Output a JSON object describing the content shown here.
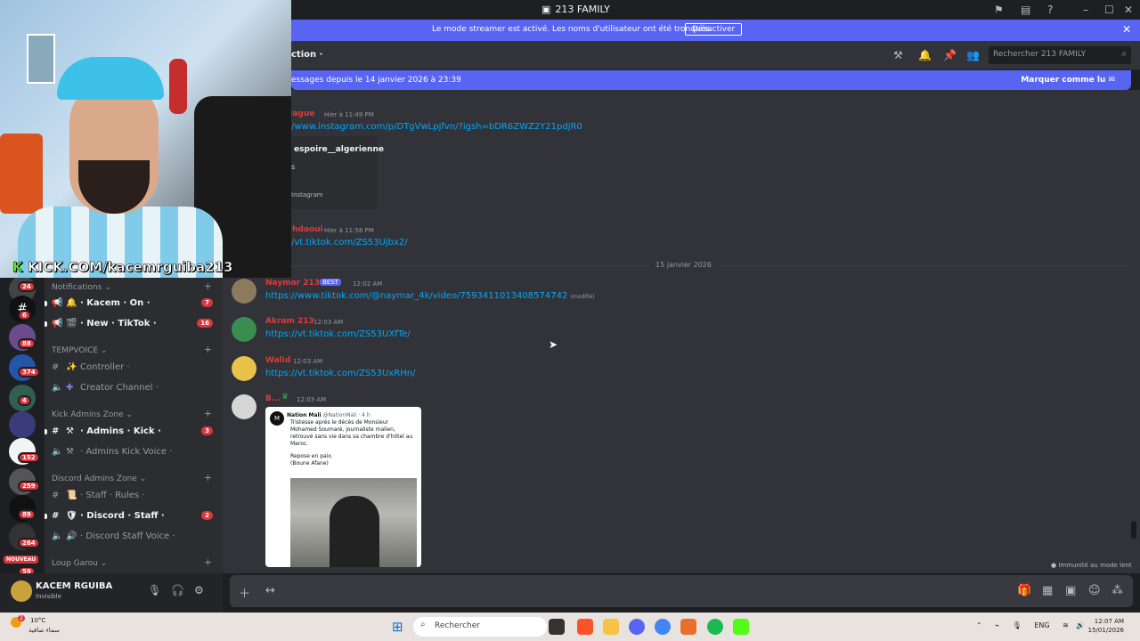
{
  "window": {
    "title": "213 FAMILY"
  },
  "banner": {
    "text": "Le mode streamer est activé. Les noms d'utilisateur ont été tronqués.",
    "button": "Désactiver"
  },
  "header": {
    "channel": "ction ·",
    "search_placeholder": "Rechercher 213 FAMILY"
  },
  "new_messages": {
    "text": "essages depuis le 14 janvier 2026 à 23:39",
    "mark_read": "Marquer comme lu"
  },
  "messages": [
    {
      "user": "Jague",
      "time": "Hier à 11:49 PM",
      "link": "/www.instagram.com/p/DTgVwLpjfvn/?igsh=bDR6ZWZ2Y21pdjR0",
      "embed_title": "espoire__algerienne",
      "embed_extra": "s",
      "embed_footer": "Instagram"
    },
    {
      "user": "hdaoui",
      "time": "Hier à 11:58 PM",
      "link": "/vt.tiktok.com/ZS53Ujbx2/"
    },
    {
      "user": "Naymar 213",
      "badge": "BEST",
      "time": "12:02 AM",
      "link": "https://www.tiktok.com/@naymar_4k/video/7593411013408574742",
      "edited": "(modifié)"
    },
    {
      "user": "Akram 213",
      "time": "12:03 AM",
      "link": "https://vt.tiktok.com/ZS53UXfTe/"
    },
    {
      "user": "Walid",
      "time": "12:03 AM",
      "link": "https://vt.tiktok.com/ZS53UxRHn/"
    },
    {
      "user": "B...",
      "time": "12:03 AM"
    }
  ],
  "date_divider": "15 janvier 2026",
  "tweet": {
    "author": "Nation Mali",
    "handle": "@NationMali · 4 h",
    "body": "Tristesse après le décès de Monsieur Mohamed Soumaré, journaliste malien, retrouvé sans vie dans sa chambre d'hôtel au Maroc.",
    "body2": "Repose en paix.",
    "body3": "(Boune Afane)"
  },
  "immunity": "Immunité au mode lent",
  "sidebar": {
    "categories": [
      {
        "label": "Notifications ⌄"
      },
      {
        "label": "TEMPVOICE ⌄"
      },
      {
        "label": "Kick Admins Zone ⌄"
      },
      {
        "label": "Discord Admins Zone ⌄"
      },
      {
        "label": "Loup Garou ⌄"
      }
    ],
    "channels": [
      {
        "label": "· Kacem · On ·",
        "count": "7"
      },
      {
        "label": "· New · TikTok ·",
        "count": "16"
      },
      {
        "label": "Controller ·"
      },
      {
        "label": "Creator Channel ·"
      },
      {
        "label": "· Admins · Kick ·",
        "count": "3"
      },
      {
        "label": "· Admins Kick Voice ·"
      },
      {
        "label": "· Staff · Rules ·"
      },
      {
        "label": "· Discord · Staff ·",
        "count": "2"
      },
      {
        "label": "· Discord Staff Voice ·"
      }
    ]
  },
  "guild_badges": [
    "24",
    "6",
    "88",
    "374",
    "4",
    "152",
    "259",
    "89",
    "264",
    "59"
  ],
  "nouveau": "NOUVEAU",
  "user": {
    "name": "KACEM RGUIBA",
    "status": "Invisible"
  },
  "taskbar": {
    "weather_temp": "10°C",
    "weather_desc": "سماء صافية",
    "weather_badge": "2",
    "search": "Rechercher",
    "lang": "ENG",
    "time": "12:07 AM",
    "date": "15/01/2026"
  },
  "stream": {
    "kick_text": "KICK.COM/kacemrguiba213"
  },
  "colors": {
    "blurple": "#5865f2",
    "link": "#00a8fc",
    "red": "#da373c"
  }
}
